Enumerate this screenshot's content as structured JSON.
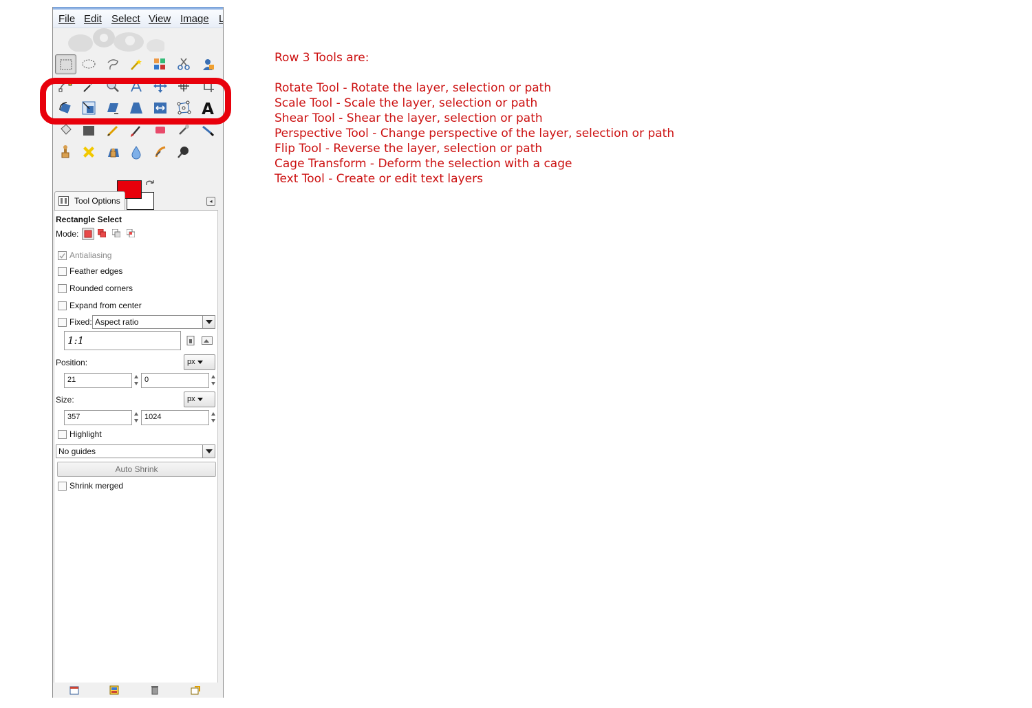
{
  "menu": {
    "file": "File",
    "edit": "Edit",
    "select": "Select",
    "view": "View",
    "image": "Image",
    "layer": "L"
  },
  "toolbox": {
    "rows": [
      [
        "rect-select-icon",
        "ellipse-select-icon",
        "free-select-icon",
        "fuzzy-select-icon",
        "select-by-color-icon",
        "scissors-select-icon",
        "foreground-select-icon"
      ],
      [
        "paths-icon",
        "color-picker-icon",
        "zoom-icon",
        "measure-icon",
        "move-icon",
        "align-icon",
        "crop-icon"
      ],
      [
        "rotate-icon",
        "scale-icon",
        "shear-icon",
        "perspective-icon",
        "flip-icon",
        "cage-transform-icon",
        "text-icon"
      ],
      [
        "bucket-fill-icon",
        "blend-icon",
        "pencil-icon",
        "paintbrush-icon",
        "eraser-icon",
        "airbrush-icon",
        "ink-icon"
      ],
      [
        "clone-icon",
        "heal-icon",
        "perspective-clone-icon",
        "blur-icon",
        "smudge-icon",
        "dodge-burn-icon"
      ]
    ],
    "fg_color": "#e8000b",
    "bg_color": "#ffffff",
    "highlight_color": "#e8000b",
    "text_tool_glyph": "A"
  },
  "dock": {
    "tab_label": "Tool Options"
  },
  "options": {
    "title": "Rectangle Select",
    "mode_label": "Mode:",
    "antialiasing": "Antialiasing",
    "feather_edges": "Feather edges",
    "rounded_corners": "Rounded corners",
    "expand_from_center": "Expand from center",
    "fixed_label": "Fixed:",
    "fixed_value": "Aspect ratio",
    "ratio_value": "1:1",
    "position_label": "Position:",
    "position_unit": "px",
    "position_x": "21",
    "position_y": "0",
    "size_label": "Size:",
    "size_unit": "px",
    "size_w": "357",
    "size_h": "1024",
    "highlight": "Highlight",
    "guides": "No guides",
    "auto_shrink": "Auto Shrink",
    "shrink_merged": "Shrink merged"
  },
  "notes": {
    "heading": "Row 3 Tools are:",
    "lines": [
      "Rotate Tool - Rotate the layer, selection or path",
      "Scale Tool - Scale the layer, selection or path",
      "Shear Tool - Shear the layer, selection or path",
      "Perspective Tool - Change perspective of the layer, selection or path",
      "Flip Tool - Reverse the layer, selection or path",
      "Cage Transform - Deform the selection with a cage",
      "Text Tool - Create or edit text layers"
    ]
  }
}
